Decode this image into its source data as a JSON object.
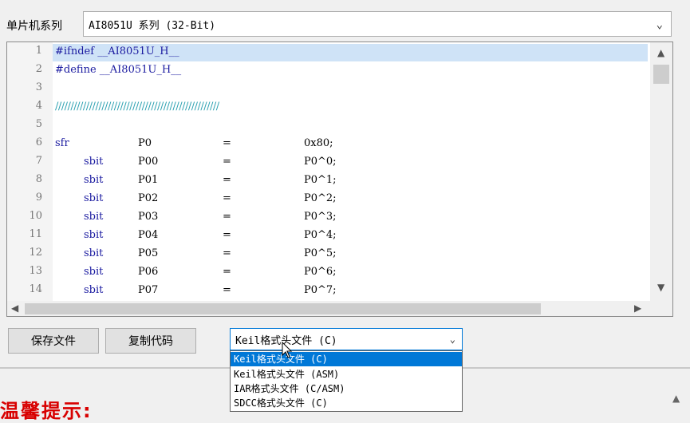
{
  "series": {
    "label": "单片机系列",
    "value": "AI8051U 系列 (32-Bit)"
  },
  "editor": {
    "lines": [
      {
        "num": "1",
        "a": "#ifndef __AI8051U_H__"
      },
      {
        "num": "2",
        "a": "#define __AI8051U_H__"
      },
      {
        "num": "3",
        "a": ""
      },
      {
        "num": "4",
        "a": "/////////////////////////////////////////////////////"
      },
      {
        "num": "5",
        "a": ""
      },
      {
        "num": "6",
        "a": "sfr",
        "b": "P0",
        "c": "=",
        "d": "0x80;"
      },
      {
        "num": "7",
        "a": "sbit",
        "b": "P00",
        "c": "=",
        "d": "P0^0;"
      },
      {
        "num": "8",
        "a": "sbit",
        "b": "P01",
        "c": "=",
        "d": "P0^1;"
      },
      {
        "num": "9",
        "a": "sbit",
        "b": "P02",
        "c": "=",
        "d": "P0^2;"
      },
      {
        "num": "10",
        "a": "sbit",
        "b": "P03",
        "c": "=",
        "d": "P0^3;"
      },
      {
        "num": "11",
        "a": "sbit",
        "b": "P04",
        "c": "=",
        "d": "P0^4;"
      },
      {
        "num": "12",
        "a": "sbit",
        "b": "P05",
        "c": "=",
        "d": "P0^5;"
      },
      {
        "num": "13",
        "a": "sbit",
        "b": "P06",
        "c": "=",
        "d": "P0^6;"
      },
      {
        "num": "14",
        "a": "sbit",
        "b": "P07",
        "c": "=",
        "d": "P0^7;"
      }
    ]
  },
  "toolbar": {
    "save_label": "保存文件",
    "copy_label": "复制代码",
    "format_value": "Keil格式头文件 (C)"
  },
  "dropdown": {
    "options": [
      "Keil格式头文件 (C)",
      "Keil格式头文件 (ASM)",
      "IAR格式头文件 (C/ASM)",
      "SDCC格式头文件 (C)"
    ],
    "selected_index": 0
  },
  "tip": {
    "text": "温馨提示:"
  },
  "colors": {
    "accent": "#0078d7",
    "tip": "#d80000",
    "keyword": "#1a1aa0",
    "comment": "#2aa0b0",
    "highlight": "#cfe3f7"
  }
}
